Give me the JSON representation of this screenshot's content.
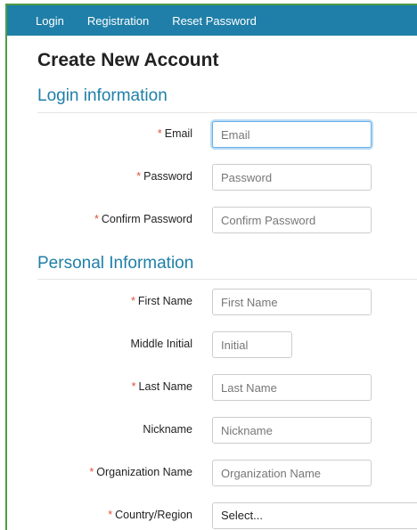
{
  "nav": {
    "login": "Login",
    "registration": "Registration",
    "reset_password": "Reset Password"
  },
  "page_title": "Create New Account",
  "login_section": {
    "title": "Login information",
    "email": {
      "label": "Email",
      "placeholder": "Email",
      "required": "*"
    },
    "password": {
      "label": "Password",
      "placeholder": "Password",
      "required": "*"
    },
    "confirm_password": {
      "label": "Confirm Password",
      "placeholder": "Confirm Password",
      "required": "*"
    }
  },
  "personal_section": {
    "title": "Personal Information",
    "first_name": {
      "label": "First Name",
      "placeholder": "First Name",
      "required": "*"
    },
    "middle_initial": {
      "label": "Middle Initial",
      "placeholder": "Initial"
    },
    "last_name": {
      "label": "Last Name",
      "placeholder": "Last Name",
      "required": "*"
    },
    "nickname": {
      "label": "Nickname",
      "placeholder": "Nickname"
    },
    "organization_name": {
      "label": "Organization Name",
      "placeholder": "Organization Name",
      "required": "*"
    },
    "country_region": {
      "label": "Country/Region",
      "selected": "Select...",
      "required": "*"
    }
  },
  "colors": {
    "navbar": "#1f7fa8",
    "section_title": "#1f7fa8",
    "required_marker": "#e0533a",
    "focus_ring": "#66afe9",
    "frame_border": "#4e9b47"
  }
}
